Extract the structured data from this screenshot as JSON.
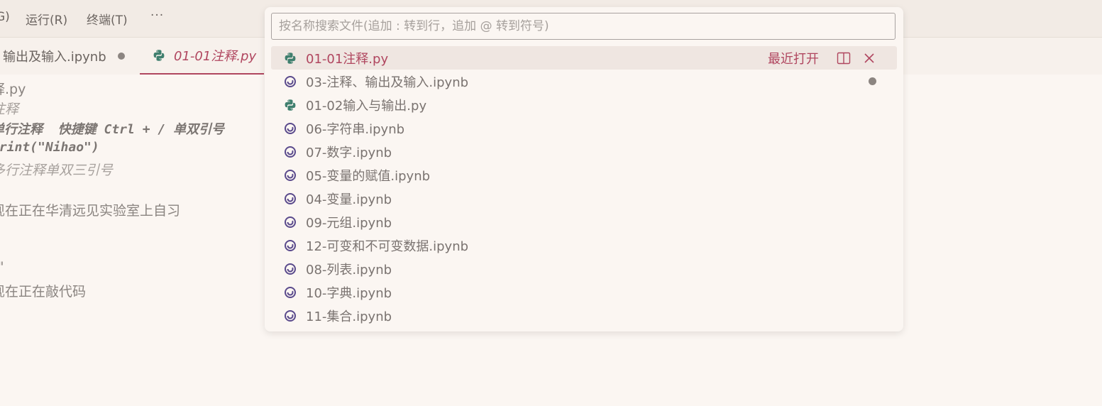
{
  "menubar": {
    "items": [
      "G)",
      "运行(R)",
      "终端(T)",
      "···"
    ]
  },
  "tabs": [
    {
      "label": "输出及输入.ipynb",
      "dirty": true,
      "icon": "jupyter-dot"
    },
    {
      "label": "01-01注释.py",
      "active": true,
      "icon": "python-icon"
    }
  ],
  "editor": {
    "lines": [
      "释.py",
      "注释",
      "单行注释  快捷键 Ctrl + / 单双引号",
      "print(\"Nihao\")",
      "多行注释单双三引号",
      "'",
      "现在正在华清远见实验室上自习",
      "",
      "'",
      "\"\"",
      "现在正在敲代码",
      "",
      "",
      "'"
    ]
  },
  "quick_open": {
    "placeholder": "按名称搜索文件(追加 : 转到行，追加 @ 转到符号)",
    "recently_opened_label": "最近打开",
    "items": [
      {
        "label": "01-01注释.py",
        "icon": "python-icon",
        "selected": true
      },
      {
        "label": "03-注释、输出及输入.ipynb",
        "icon": "jupyter-icon",
        "dirty": true
      },
      {
        "label": "01-02输入与输出.py",
        "icon": "python-icon"
      },
      {
        "label": "06-字符串.ipynb",
        "icon": "jupyter-icon"
      },
      {
        "label": "07-数字.ipynb",
        "icon": "jupyter-icon"
      },
      {
        "label": "05-变量的赋值.ipynb",
        "icon": "jupyter-icon"
      },
      {
        "label": "04-变量.ipynb",
        "icon": "jupyter-icon"
      },
      {
        "label": "09-元组.ipynb",
        "icon": "jupyter-icon"
      },
      {
        "label": "12-可变和不可变数据.ipynb",
        "icon": "jupyter-icon"
      },
      {
        "label": "08-列表.ipynb",
        "icon": "jupyter-icon"
      },
      {
        "label": "10-字典.ipynb",
        "icon": "jupyter-icon"
      },
      {
        "label": "11-集合.ipynb",
        "icon": "jupyter-icon"
      }
    ]
  },
  "colors": {
    "accent": "#b0465f",
    "python_icon": "#3f7f6e",
    "jupyter_icon": "#5a4a8c"
  }
}
